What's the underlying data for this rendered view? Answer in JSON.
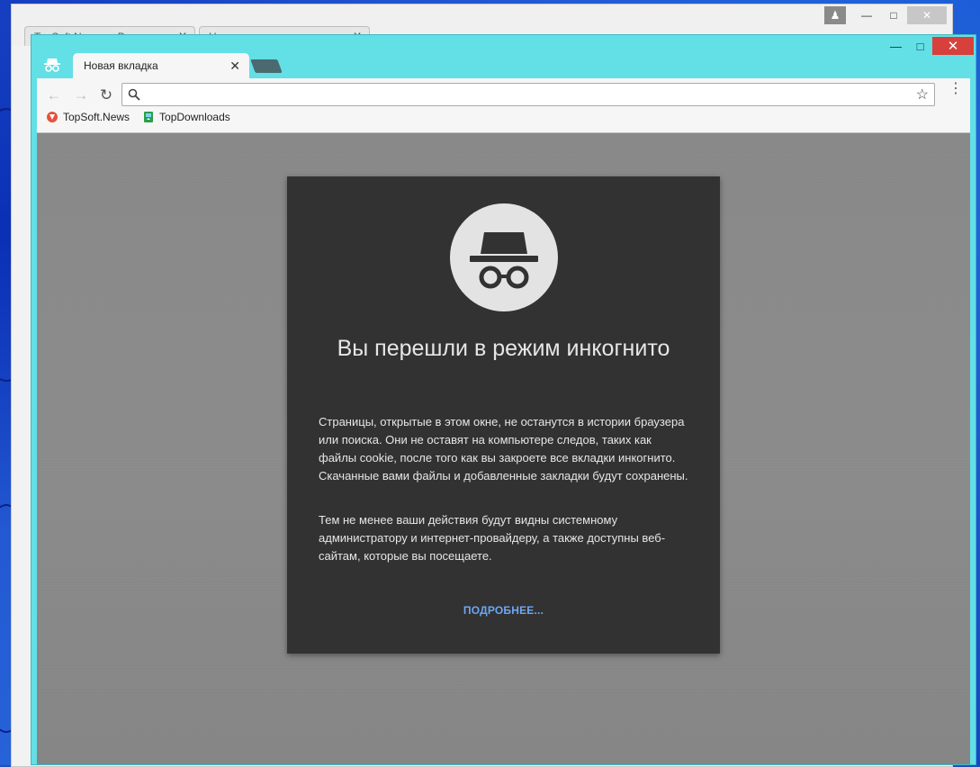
{
  "background_window": {
    "tabs": [
      {
        "label": "TopSoft.News — Все о..."
      },
      {
        "label": "Новая вкладка"
      }
    ]
  },
  "window": {
    "tab": {
      "label": "Новая вкладка"
    },
    "omnibox": {
      "value": "",
      "placeholder": ""
    },
    "bookmarks": [
      {
        "label": "TopSoft.News"
      },
      {
        "label": "TopDownloads"
      }
    ]
  },
  "incognito": {
    "title": "Вы перешли в режим инкогнито",
    "paragraph1": "Страницы, открытые в этом окне, не останутся в истории браузера или поиска. Они не оставят на компьютере следов, таких как файлы cookie, после того как вы закроете все вкладки инкогнито. Скачанные вами файлы и добавленные закладки будут сохранены.",
    "paragraph2": "Тем не менее ваши действия будут видны системному администратору и интернет-провайдеру, а также доступны веб-сайтам, которые вы посещаете.",
    "learn_more": "ПОДРОБНЕЕ..."
  },
  "colors": {
    "frame": "#63dfe6",
    "card": "#323232",
    "link": "#6ea7f3",
    "close": "#d8403b"
  }
}
